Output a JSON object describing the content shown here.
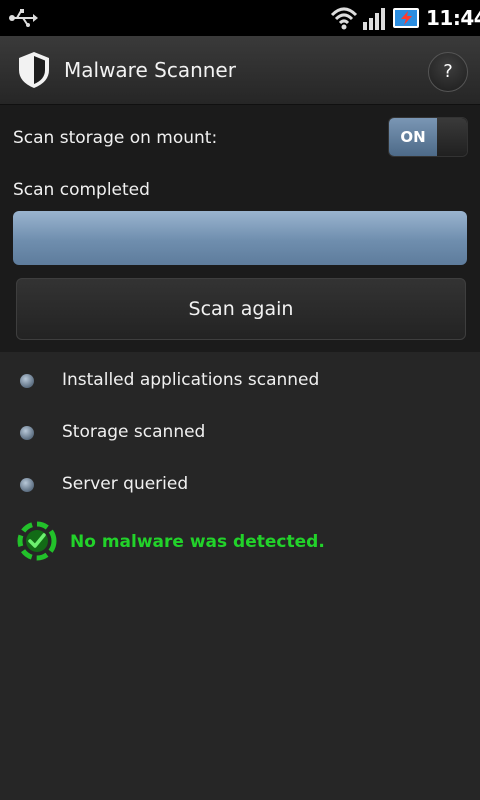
{
  "status_bar": {
    "time": "11:44",
    "icons": [
      "usb-icon",
      "wifi-icon",
      "signal-icon",
      "battery-charging-icon"
    ]
  },
  "header": {
    "icon": "shield-icon",
    "title": "Malware Scanner",
    "help_label": "?"
  },
  "settings": {
    "scan_on_mount_label": "Scan storage on mount:",
    "toggle_label": "ON",
    "toggle_state": "on"
  },
  "scan": {
    "status": "Scan completed",
    "progress": 1.0,
    "button_label": "Scan again"
  },
  "checklist": [
    {
      "label": "Installed applications scanned"
    },
    {
      "label": "Storage scanned"
    },
    {
      "label": "Server queried"
    }
  ],
  "result": {
    "icon": "green-check-icon",
    "message": "No malware was detected."
  },
  "colors": {
    "background": "#262626",
    "panel": "#1b1b1b",
    "accent_blue": "#7a96b4",
    "success_green": "#22d22a"
  }
}
